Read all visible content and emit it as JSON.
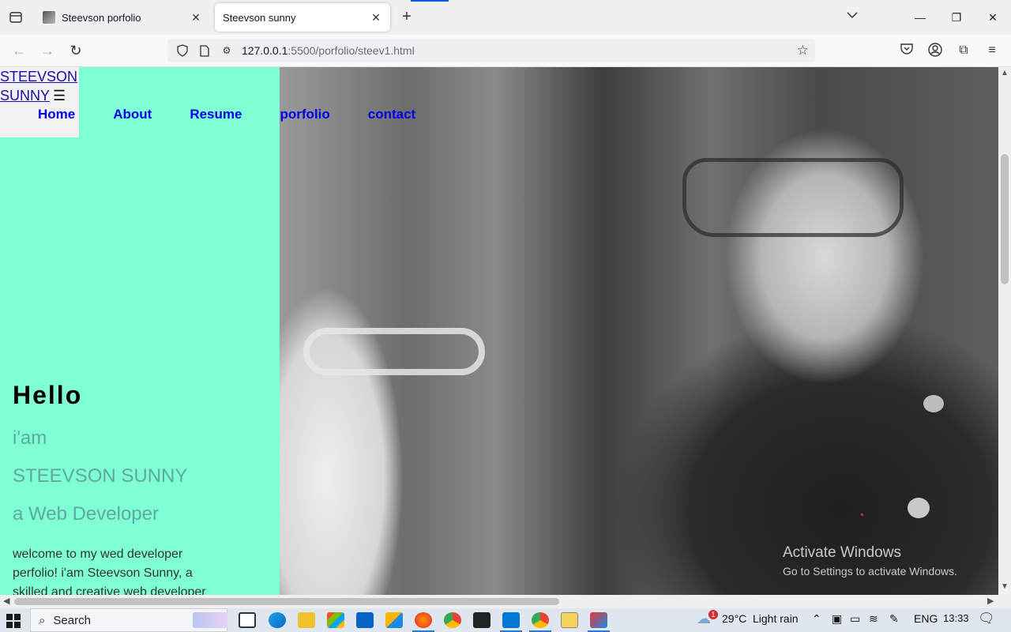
{
  "browser": {
    "tabs": [
      {
        "title": "Steevson porfolio",
        "active": false
      },
      {
        "title": "Steevson sunny",
        "active": true
      }
    ],
    "url_host": "127.0.0.1",
    "url_path": ":5500/porfolio/steev1.html"
  },
  "page": {
    "logo_line1": "STEEVSON",
    "logo_line2": "SUNNY",
    "menu_icon": "☰",
    "nav": [
      "Home",
      "About",
      "Resume",
      "porfolio",
      "contact"
    ],
    "hello": "Hello",
    "iam": "i'am",
    "name": "STEEVSON SUNNY",
    "role": "a Web Developer",
    "welcome": "welcome to my wed developer perfolio! i'am Steevson Sunny, a skilled and creative web developer",
    "hero_bg_color": "#7fffd4"
  },
  "watermark": {
    "title": "Activate Windows",
    "subtitle": "Go to Settings to activate Windows."
  },
  "taskbar": {
    "search_label": "Search",
    "weather_temp": "29°C",
    "weather_desc": "Light rain",
    "weather_badge": "1",
    "language": "ENG",
    "time": "13:33"
  }
}
